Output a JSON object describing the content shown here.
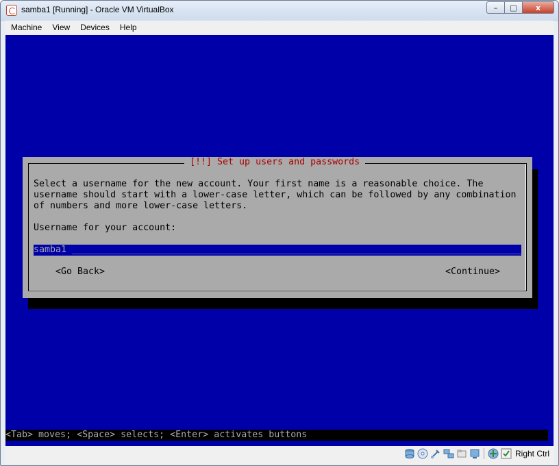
{
  "window": {
    "title": "samba1 [Running] - Oracle VM VirtualBox",
    "controls": {
      "minimize": "–",
      "maximize": "□",
      "close": "x"
    }
  },
  "menubar": {
    "items": [
      "Machine",
      "View",
      "Devices",
      "Help"
    ]
  },
  "installer": {
    "dialog_title": "[!!] Set up users and passwords",
    "description": "Select a username for the new account. Your first name is a reasonable choice. The\nusername should start with a lower-case letter, which can be followed by any combination\nof numbers and more lower-case letters.",
    "field_label": "Username for your account:",
    "field_value": "samba1",
    "go_back_label": "<Go Back>",
    "continue_label": "<Continue>",
    "help_line": "<Tab> moves; <Space> selects; <Enter> activates buttons"
  },
  "statusbar": {
    "icons": [
      "hard-disk-icon",
      "optical-drive-icon",
      "usb-icon",
      "network-icon",
      "shared-folders-icon",
      "display-icon",
      "capture-icon",
      "host-key-icon"
    ],
    "host_key": "Right Ctrl"
  },
  "colors": {
    "screen_bg": "#0000a8",
    "dialog_bg": "#aaaaaa",
    "title_red": "#aa0000"
  }
}
